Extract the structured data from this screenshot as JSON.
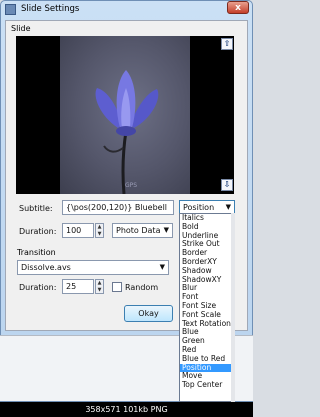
{
  "window": {
    "title": "Slide Settings",
    "close_glyph": "x"
  },
  "slide": {
    "group_label": "Slide",
    "watermark": "GPS",
    "up_glyph": "⇧",
    "down_glyph": "⇩"
  },
  "subtitle": {
    "label": "Subtitle:",
    "value": "{\\pos(200,120)} Bluebell",
    "tag_combo": "Position"
  },
  "duration1": {
    "label": "Duration:",
    "value": "100",
    "combo": "Photo Data"
  },
  "transition": {
    "group_label": "Transition",
    "combo": "Dissolve.avs"
  },
  "duration2": {
    "label": "Duration:",
    "value": "25",
    "random_label": "Random"
  },
  "ok_label": "Okay",
  "dropdown_items": [
    "Italics",
    "Bold",
    "Underline",
    "Strike Out",
    "Border",
    "BorderXY",
    "Shadow",
    "ShadowXY",
    "Blur",
    "Font",
    "Font Size",
    "Font Scale",
    "Text Rotation",
    "Blue",
    "Green",
    "Red",
    "Blue to Red",
    "Position",
    "Move",
    "Top Center"
  ],
  "dropdown_selected": "Position",
  "footer": "358x571  101kb  PNG"
}
